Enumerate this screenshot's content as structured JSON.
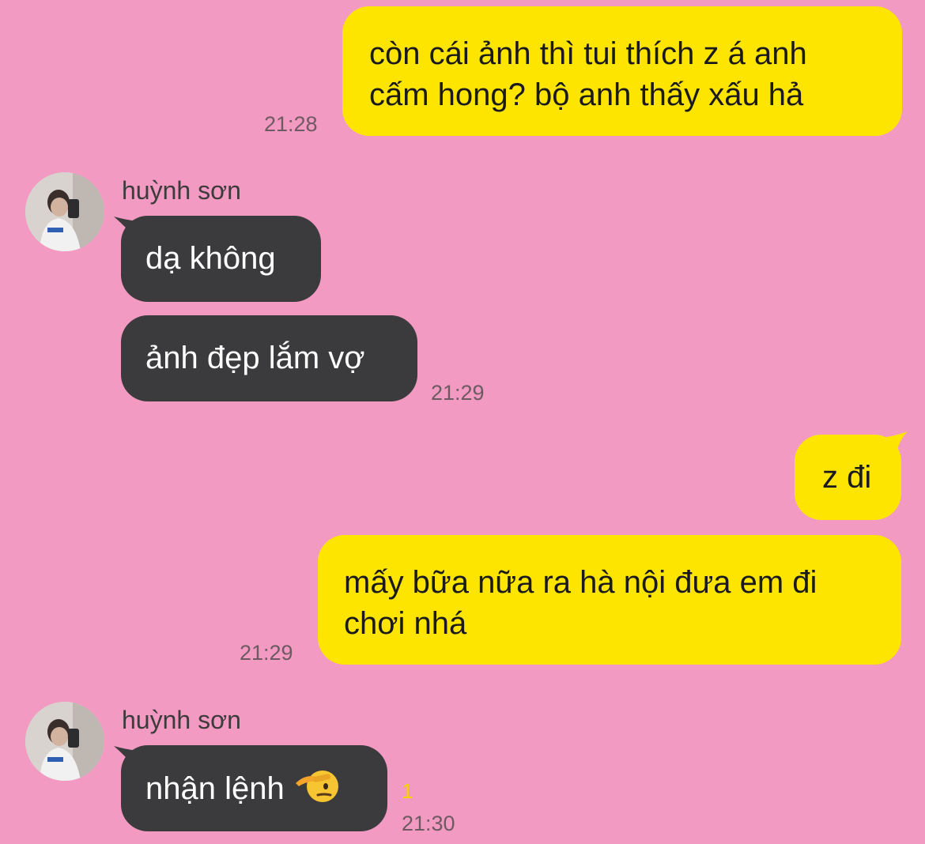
{
  "chat": {
    "messages": [
      {
        "sender": "me",
        "lines": [
          "còn cái ảnh thì tui thích z á anh",
          "cấm hong? bộ anh thấy xấu hả"
        ],
        "time": "21:28"
      },
      {
        "sender": "huỳnh sơn",
        "lines": [
          "dạ không"
        ],
        "time": ""
      },
      {
        "sender": "huỳnh sơn",
        "lines": [
          "ảnh đẹp lắm vợ"
        ],
        "time": "21:29"
      },
      {
        "sender": "me",
        "lines": [
          "z đi"
        ],
        "time": ""
      },
      {
        "sender": "me",
        "lines": [
          "mấy bữa nữa ra hà nội đưa em đi",
          "chơi nhá"
        ],
        "time": "21:29"
      },
      {
        "sender": "huỳnh sơn",
        "lines": [
          "nhận lệnh"
        ],
        "emoji": "saluting-face-emoji",
        "time": "21:30",
        "unread": "1"
      }
    ],
    "contact_name": "huỳnh sơn"
  },
  "colors": {
    "background": "#f29ac2",
    "outgoing_bubble": "#fee500",
    "incoming_bubble": "#3b3b3d",
    "unread_count": "#f5d300"
  }
}
